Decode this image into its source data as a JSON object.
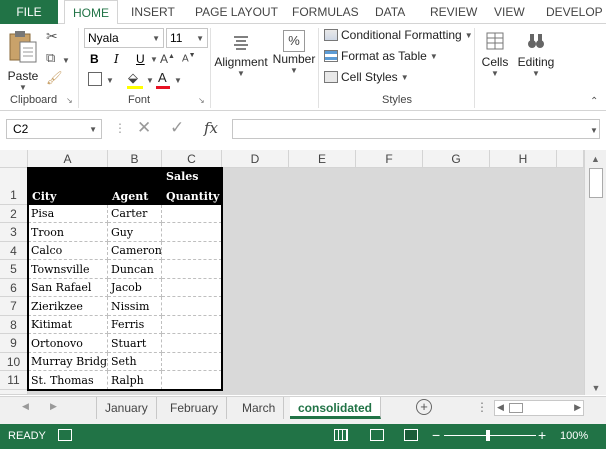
{
  "tabs": {
    "file": "FILE",
    "home": "HOME",
    "insert": "INSERT",
    "page_layout": "PAGE LAYOUT",
    "formulas": "FORMULAS",
    "data": "DATA",
    "review": "REVIEW",
    "view": "VIEW",
    "developer": "DEVELOP"
  },
  "ribbon": {
    "clipboard": {
      "paste": "Paste",
      "label": "Clipboard"
    },
    "font": {
      "name": "Nyala",
      "size": "11",
      "label": "Font",
      "bold": "B",
      "italic": "I",
      "underline": "U",
      "color_letter": "A"
    },
    "alignment": {
      "label": "Alignment"
    },
    "number": {
      "label": "Number",
      "symbol": "%"
    },
    "styles": {
      "conditional": "Conditional Formatting",
      "table": "Format as Table",
      "cell": "Cell Styles",
      "label": "Styles"
    },
    "cells": {
      "label": "Cells"
    },
    "editing": {
      "label": "Editing"
    }
  },
  "formula_bar": {
    "name_box": "C2",
    "fx": "fx",
    "value": ""
  },
  "columns": [
    "A",
    "B",
    "C",
    "D",
    "E",
    "F",
    "G",
    "H"
  ],
  "rows": [
    "1",
    "2",
    "3",
    "4",
    "5",
    "6",
    "7",
    "8",
    "9",
    "10",
    "11"
  ],
  "table": {
    "headers": {
      "city": "City",
      "agent": "Agent",
      "sales_top": "Sales",
      "sales_bottom": "Quantity"
    },
    "data": [
      [
        "Pisa",
        "Carter"
      ],
      [
        "Troon",
        "Guy"
      ],
      [
        "Calco",
        "Cameron"
      ],
      [
        "Townsville",
        "Duncan"
      ],
      [
        "San Rafael",
        "Jacob"
      ],
      [
        "Zierikzee",
        "Nissim"
      ],
      [
        "Kitimat",
        "Ferris"
      ],
      [
        "Ortonovo",
        "Stuart"
      ],
      [
        "Murray Bridge",
        "Seth"
      ],
      [
        "St. Thomas",
        "Ralph"
      ]
    ]
  },
  "sheets": [
    "January",
    "February",
    "March",
    "consolidated"
  ],
  "status": {
    "ready": "READY",
    "zoom": "100%"
  },
  "colors": {
    "accent": "#217346",
    "header_fill": "#000000"
  }
}
